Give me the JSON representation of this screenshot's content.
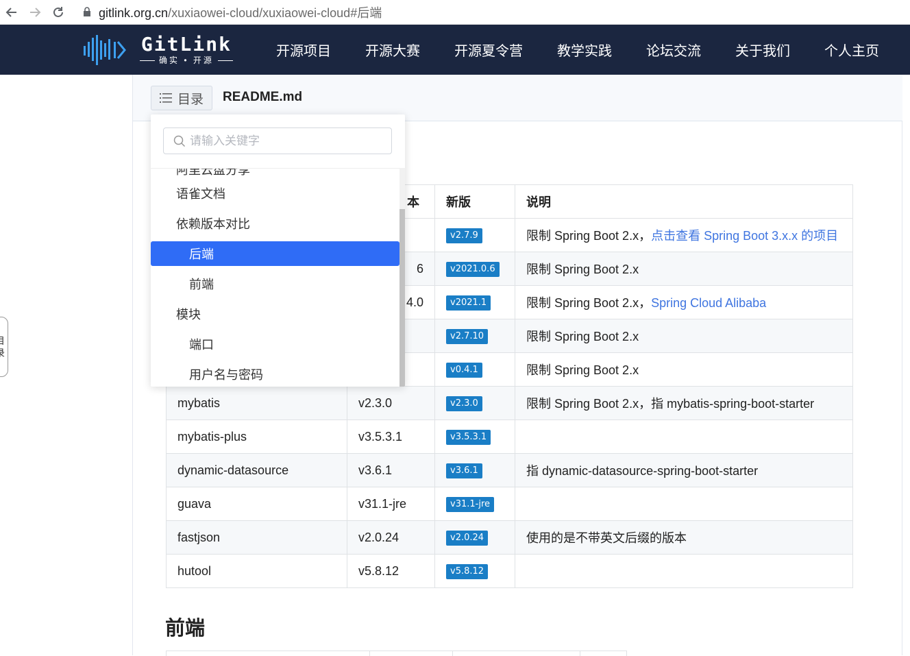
{
  "browser": {
    "url_host": "gitlink.org.cn",
    "url_path": "/xuxiaowei-cloud/xuxiaowei-cloud#后端"
  },
  "header": {
    "logo_title": "GitLink",
    "logo_subtitle": "确实 • 开源",
    "nav": [
      "开源项目",
      "开源大赛",
      "开源夏令营",
      "教学实践",
      "论坛交流",
      "关于我们",
      "个人主页"
    ]
  },
  "filebar": {
    "toc_label": "目录",
    "file_name": "README.md"
  },
  "toc": {
    "search_placeholder": "请输入关键字",
    "cut_item": "阿里云盘分享",
    "items": [
      {
        "label": "语雀文档",
        "level": 1,
        "active": false
      },
      {
        "label": "依赖版本对比",
        "level": 1,
        "active": false
      },
      {
        "label": "后端",
        "level": 2,
        "active": true
      },
      {
        "label": "前端",
        "level": 2,
        "active": false
      },
      {
        "label": "模块",
        "level": 1,
        "active": false
      },
      {
        "label": "端口",
        "level": 2,
        "active": false
      },
      {
        "label": "用户名与密码",
        "level": 2,
        "active": false
      }
    ]
  },
  "table": {
    "headers": [
      "",
      "本",
      "新版",
      "说明"
    ],
    "rows": [
      {
        "name": "",
        "old": "",
        "new": "v2.7.9",
        "desc": "限制 Spring Boot 2.x，",
        "link": "点击查看 Spring Boot 3.x.x 的项目"
      },
      {
        "name": "",
        "old": "6",
        "new": "v2021.0.6",
        "desc": "限制 Spring Boot 2.x",
        "link": ""
      },
      {
        "name": "",
        "old": "4.0",
        "new": "v2021.1",
        "desc": "限制 Spring Boot 2.x，",
        "link": "Spring Cloud Alibaba"
      },
      {
        "name": "",
        "old": "",
        "new": "v2.7.10",
        "desc": "限制 Spring Boot 2.x",
        "link": ""
      },
      {
        "name": "",
        "old": "",
        "new": "v0.4.1",
        "desc": "限制 Spring Boot 2.x",
        "link": ""
      },
      {
        "name": "mybatis",
        "old": "v2.3.0",
        "new": "v2.3.0",
        "desc": "限制 Spring Boot 2.x，指 mybatis-spring-boot-starter",
        "link": ""
      },
      {
        "name": "mybatis-plus",
        "old": "v3.5.3.1",
        "new": "v3.5.3.1",
        "desc": "",
        "link": ""
      },
      {
        "name": "dynamic-datasource",
        "old": "v3.6.1",
        "new": "v3.6.1",
        "desc": "指 dynamic-datasource-spring-boot-starter",
        "link": ""
      },
      {
        "name": "guava",
        "old": "v31.1-jre",
        "new": "v31.1-jre",
        "desc": "",
        "link": ""
      },
      {
        "name": "fastjson",
        "old": "v2.0.24",
        "new": "v2.0.24",
        "desc": "使用的是不带英文后缀的版本",
        "link": ""
      },
      {
        "name": "hutool",
        "old": "v5.8.12",
        "new": "v5.8.12",
        "desc": "",
        "link": ""
      }
    ]
  },
  "section": {
    "title": "前端"
  },
  "side_tab": {
    "chars": [
      "目",
      "录"
    ]
  },
  "colors": {
    "header_bg": "#1b2640",
    "badge_bg": "#1a7ec6",
    "active_bg": "#2f6cf6",
    "link": "#3f75e0"
  }
}
